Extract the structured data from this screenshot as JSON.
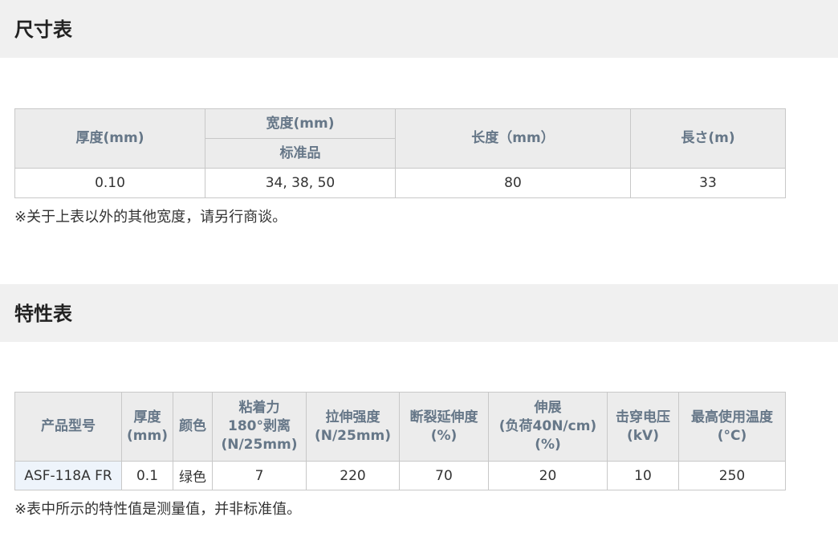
{
  "size_section": {
    "title": "尺寸表",
    "headers": {
      "thickness": "厚度(mm)",
      "width": "宽度(mm)",
      "width_sub": "标准品",
      "length": "长度（mm）",
      "length_m": "長さ(m)"
    },
    "row": {
      "thickness": "0.10",
      "width": "34, 38, 50",
      "length": "80",
      "length_m": "33"
    },
    "note": "※关于上表以外的其他宽度，请另行商谈。"
  },
  "property_section": {
    "title": "特性表",
    "headers": {
      "model": "产品型号",
      "thickness_1": "厚度",
      "thickness_2": "(mm)",
      "color": "颜色",
      "adhesion_1": "粘着力",
      "adhesion_2": "180°剥离",
      "adhesion_3": "(N/25mm)",
      "tensile_1": "拉伸强度",
      "tensile_2": "(N/25mm)",
      "elongation_1": "断裂延伸度",
      "elongation_2": "(%)",
      "stretch_1": "伸展",
      "stretch_2": "(负荷40N/cm)",
      "stretch_3": "(%)",
      "breakdown_1": "击穿电压",
      "breakdown_2": "(kV)",
      "maxtemp_1": "最高使用温度",
      "maxtemp_2": "(°C)"
    },
    "row": {
      "model": "ASF-118A FR",
      "thickness": "0.1",
      "color": "绿色",
      "adhesion": "7",
      "tensile": "220",
      "elongation": "70",
      "stretch": "20",
      "breakdown": "10",
      "maxtemp": "250"
    },
    "note": "※表中所示的特性值是测量值，并非标准值。"
  }
}
